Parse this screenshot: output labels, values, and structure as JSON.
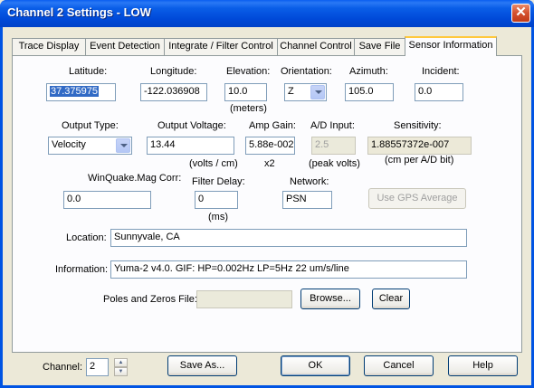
{
  "window": {
    "title": "Channel 2 Settings - LOW",
    "close_label": "✕"
  },
  "tabs": [
    {
      "label": "Trace Display"
    },
    {
      "label": "Event Detection"
    },
    {
      "label": "Integrate / Filter Control"
    },
    {
      "label": "Channel Control"
    },
    {
      "label": "Save File"
    },
    {
      "label": "Sensor Information",
      "active": true
    }
  ],
  "sensor": {
    "latitude": {
      "label": "Latitude:",
      "value": "37.375975"
    },
    "longitude": {
      "label": "Longitude:",
      "value": "-122.036908"
    },
    "elevation": {
      "label": "Elevation:",
      "value": "10.0",
      "unit": "(meters)"
    },
    "orientation": {
      "label": "Orientation:",
      "value": "Z"
    },
    "azimuth": {
      "label": "Azimuth:",
      "value": "105.0"
    },
    "incident": {
      "label": "Incident:",
      "value": "0.0"
    },
    "output_type": {
      "label": "Output Type:",
      "value": "Velocity"
    },
    "output_voltage": {
      "label": "Output Voltage:",
      "value": "13.44",
      "unit": "(volts / cm)"
    },
    "amp_gain": {
      "label": "Amp Gain:",
      "value": "5.88e-002",
      "unit": "x2"
    },
    "ad_input": {
      "label": "A/D Input:",
      "value": "2.5",
      "unit": "(peak volts)"
    },
    "sensitivity": {
      "label": "Sensitivity:",
      "value": "1.88557372e-007",
      "unit": "(cm per A/D bit)"
    },
    "winquake_mag_corr": {
      "label": "WinQuake.Mag Corr:",
      "value": "0.0"
    },
    "filter_delay": {
      "label": "Filter Delay:",
      "value": "0",
      "unit": "(ms)"
    },
    "network": {
      "label": "Network:",
      "value": "PSN"
    },
    "use_gps_average_label": "Use GPS Average",
    "location": {
      "label": "Location:",
      "value": "Sunnyvale, CA"
    },
    "information": {
      "label": "Information:",
      "value": "Yuma-2 v4.0. GIF: HP=0.002Hz LP=5Hz 22 um/s/line"
    },
    "poles_zeros": {
      "label": "Poles and Zeros File:",
      "value": "",
      "browse_label": "Browse...",
      "clear_label": "Clear"
    }
  },
  "footer": {
    "channel_label": "Channel:",
    "channel_value": "2",
    "save_as_label": "Save As...",
    "ok_label": "OK",
    "cancel_label": "Cancel",
    "help_label": "Help"
  },
  "colors": {
    "titlebar": "#0054e3",
    "dialog_bg": "#ece9d8",
    "panel_bg": "#fcfcfe",
    "selection": "#316ac5"
  }
}
